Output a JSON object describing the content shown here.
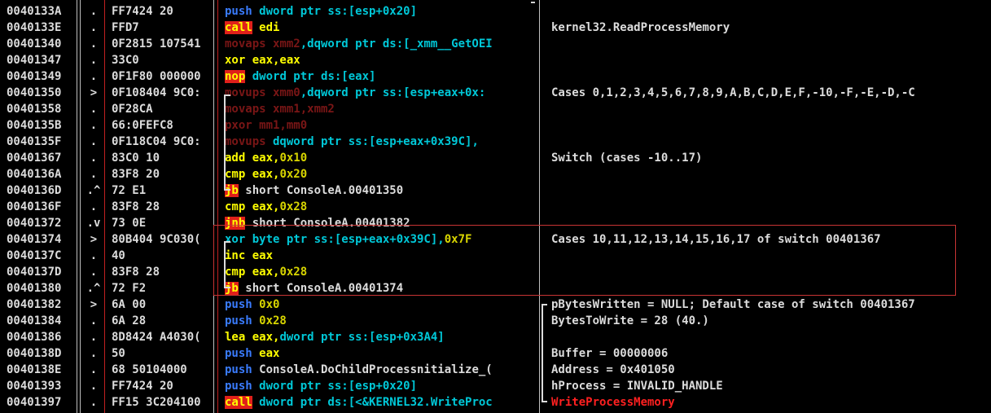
{
  "rows": [
    {
      "addr": "0040133A",
      "mark": ".",
      "hex": "FF7424 20",
      "dis": [
        {
          "t": "push",
          "c": "push"
        },
        {
          "t": " dword ptr ss:[esp+0x20]",
          "c": "mem"
        }
      ],
      "cmt": ""
    },
    {
      "addr": "0040133E",
      "mark": ".",
      "hex": "FFD7",
      "dis": [
        {
          "t": "call",
          "c": "call"
        },
        {
          "t": " edi",
          "c": "reg"
        }
      ],
      "cmt": "kernel32.ReadProcessMemory"
    },
    {
      "addr": "00401340",
      "mark": ".",
      "hex": "0F2815 107541",
      "dis": [
        {
          "t": "movaps xmm2",
          "c": "sse"
        },
        {
          "t": ",dqword ptr ds:[_xmm__GetOEI",
          "c": "mem"
        }
      ],
      "cmt": ""
    },
    {
      "addr": "00401347",
      "mark": ".",
      "hex": "33C0",
      "dis": [
        {
          "t": "xor eax,eax",
          "c": "ins"
        }
      ],
      "cmt": ""
    },
    {
      "addr": "00401349",
      "mark": ".",
      "hex": "0F1F80 000000",
      "dis": [
        {
          "t": "nop",
          "c": "nop"
        },
        {
          "t": " dword ptr ds:[eax]",
          "c": "mem"
        }
      ],
      "cmt": ""
    },
    {
      "addr": "00401350",
      "mark": ">",
      "hex": "0F108404 9C0:",
      "dis": [
        {
          "t": "movups xmm0",
          "c": "sse"
        },
        {
          "t": ",dqword ptr ss:[esp+eax+0x:",
          "c": "mem"
        }
      ],
      "cmt": "Cases 0,1,2,3,4,5,6,7,8,9,A,B,C,D,E,F,-10,-F,-E,-D,-C"
    },
    {
      "addr": "00401358",
      "mark": ".",
      "hex": "0F28CA",
      "dis": [
        {
          "t": "movaps xmm1,xmm2",
          "c": "sse"
        }
      ],
      "cmt": ""
    },
    {
      "addr": "0040135B",
      "mark": ".",
      "hex": "66:0FEFC8",
      "dis": [
        {
          "t": "pxor mm1,mm0",
          "c": "sse"
        }
      ],
      "cmt": ""
    },
    {
      "addr": "0040135F",
      "mark": ".",
      "hex": "0F118C04 9C0:",
      "dis": [
        {
          "t": "movups",
          "c": "sse"
        },
        {
          "t": " dqword ptr ss:[esp+eax+0x39C],",
          "c": "mem"
        }
      ],
      "cmt": ""
    },
    {
      "addr": "00401367",
      "mark": ".",
      "hex": "83C0 10",
      "dis": [
        {
          "t": "add eax,",
          "c": "ins"
        },
        {
          "t": "0x10",
          "c": "num"
        }
      ],
      "cmt": "Switch (cases -10..17)"
    },
    {
      "addr": "0040136A",
      "mark": ".",
      "hex": "83F8 20",
      "dis": [
        {
          "t": "cmp eax,",
          "c": "ins"
        },
        {
          "t": "0x20",
          "c": "num"
        }
      ],
      "cmt": ""
    },
    {
      "addr": "0040136D",
      "mark": ".^",
      "hex": "72 E1",
      "dis": [
        {
          "t": "jb",
          "c": "jcc"
        },
        {
          "t": " short ConsoleA.00401350",
          "c": "sym"
        }
      ],
      "cmt": ""
    },
    {
      "addr": "0040136F",
      "mark": ".",
      "hex": "83F8 28",
      "dis": [
        {
          "t": "cmp eax,",
          "c": "ins"
        },
        {
          "t": "0x28",
          "c": "num"
        }
      ],
      "cmt": ""
    },
    {
      "addr": "00401372",
      "mark": ".v",
      "hex": "73 0E",
      "dis": [
        {
          "t": "jnb",
          "c": "jcc"
        },
        {
          "t": " short ConsoleA.00401382",
          "c": "sym"
        }
      ],
      "cmt": ""
    },
    {
      "addr": "00401374",
      "mark": ">",
      "hex": "80B404 9C030(",
      "dis": [
        {
          "t": "xor byte ptr ss:[esp+eax+0x39C],",
          "c": "mem"
        },
        {
          "t": "0x7F",
          "c": "num"
        }
      ],
      "cmt": "Cases 10,11,12,13,14,15,16,17 of switch 00401367"
    },
    {
      "addr": "0040137C",
      "mark": ".",
      "hex": "40",
      "dis": [
        {
          "t": "inc eax",
          "c": "ins"
        }
      ],
      "cmt": ""
    },
    {
      "addr": "0040137D",
      "mark": ".",
      "hex": "83F8 28",
      "dis": [
        {
          "t": "cmp eax,",
          "c": "ins"
        },
        {
          "t": "0x28",
          "c": "num"
        }
      ],
      "cmt": ""
    },
    {
      "addr": "00401380",
      "mark": ".^",
      "hex": "72 F2",
      "dis": [
        {
          "t": "jb",
          "c": "jcc"
        },
        {
          "t": " short ConsoleA.00401374",
          "c": "sym"
        }
      ],
      "cmt": ""
    },
    {
      "addr": "00401382",
      "mark": ">",
      "hex": "6A 00",
      "dis": [
        {
          "t": "push",
          "c": "push"
        },
        {
          "t": " 0x0",
          "c": "num"
        }
      ],
      "cmt": "pBytesWritten = NULL; Default case of switch 00401367"
    },
    {
      "addr": "00401384",
      "mark": ".",
      "hex": "6A 28",
      "dis": [
        {
          "t": "push",
          "c": "push"
        },
        {
          "t": " 0x28",
          "c": "num"
        }
      ],
      "cmt": "BytesToWrite = 28 (40.)"
    },
    {
      "addr": "00401386",
      "mark": ".",
      "hex": "8D8424 A4030(",
      "dis": [
        {
          "t": "lea eax,",
          "c": "ins"
        },
        {
          "t": "dword ptr ss:[esp+0x3A4]",
          "c": "mem"
        }
      ],
      "cmt": ""
    },
    {
      "addr": "0040138D",
      "mark": ".",
      "hex": "50",
      "dis": [
        {
          "t": "push",
          "c": "push"
        },
        {
          "t": " eax",
          "c": "reg"
        }
      ],
      "cmt": "Buffer = 00000006"
    },
    {
      "addr": "0040138E",
      "mark": ".",
      "hex": "68 50104000",
      "dis": [
        {
          "t": "push",
          "c": "push"
        },
        {
          "t": " ConsoleA.DoChildProcessnitialize_(",
          "c": "sym"
        }
      ],
      "cmt": "Address = 0x401050"
    },
    {
      "addr": "00401393",
      "mark": ".",
      "hex": "FF7424 20",
      "dis": [
        {
          "t": "push",
          "c": "push"
        },
        {
          "t": " dword ptr ss:[esp+0x20]",
          "c": "mem"
        }
      ],
      "cmt": "hProcess = INVALID_HANDLE"
    },
    {
      "addr": "00401397",
      "mark": ".",
      "hex": "FF15 3C204100",
      "dis": [
        {
          "t": "call",
          "c": "call"
        },
        {
          "t": " dword ptr ds:[<&KERNEL32.WriteProc",
          "c": "mem"
        }
      ],
      "cmt": "WriteProcessMemory",
      "cmt_red": true
    }
  ],
  "colors": {
    "bg": "#000000",
    "text": "#dcdcdc",
    "push": "#3a7cff",
    "call_bg": "#e0201a",
    "keyword": "#ffff00",
    "sse": "#7a1616",
    "mem": "#00c8d8",
    "highlight_box": "#c83434"
  }
}
